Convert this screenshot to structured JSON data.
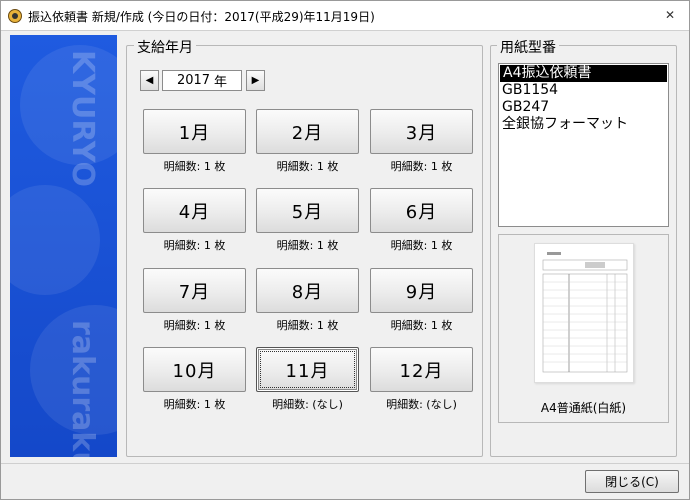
{
  "window": {
    "title": "振込依頼書 新規/作成 (今日の日付：2017(平成29)年11月19日)",
    "close_glyph": "✕"
  },
  "sidebar": {
    "text_top": "KYURYO",
    "text_bottom": "rakuraku"
  },
  "payment_month": {
    "label": "支給年月",
    "year": {
      "value": "2017",
      "unit": "年",
      "prev_glyph": "◀",
      "next_glyph": "▶"
    },
    "months": [
      {
        "label": "1月",
        "count": "明細数:  1 枚"
      },
      {
        "label": "2月",
        "count": "明細数:  1 枚"
      },
      {
        "label": "3月",
        "count": "明細数:  1 枚"
      },
      {
        "label": "4月",
        "count": "明細数:  1 枚"
      },
      {
        "label": "5月",
        "count": "明細数:  1 枚"
      },
      {
        "label": "6月",
        "count": "明細数:  1 枚"
      },
      {
        "label": "7月",
        "count": "明細数:  1 枚"
      },
      {
        "label": "8月",
        "count": "明細数:  1 枚"
      },
      {
        "label": "9月",
        "count": "明細数:  1 枚"
      },
      {
        "label": "10月",
        "count": "明細数:  1 枚"
      },
      {
        "label": "11月",
        "count": "明細数:  (なし)"
      },
      {
        "label": "12月",
        "count": "明細数:  (なし)"
      }
    ],
    "selected_month_index": 10
  },
  "paper_type": {
    "label": "用紙型番",
    "items": [
      "A4振込依頼書",
      "GB1154",
      "GB247",
      "全銀協フォーマット"
    ],
    "selected_index": 0
  },
  "preview": {
    "caption": "A4普通紙(白紙)"
  },
  "footer": {
    "close_label": "閉じる(C)"
  }
}
